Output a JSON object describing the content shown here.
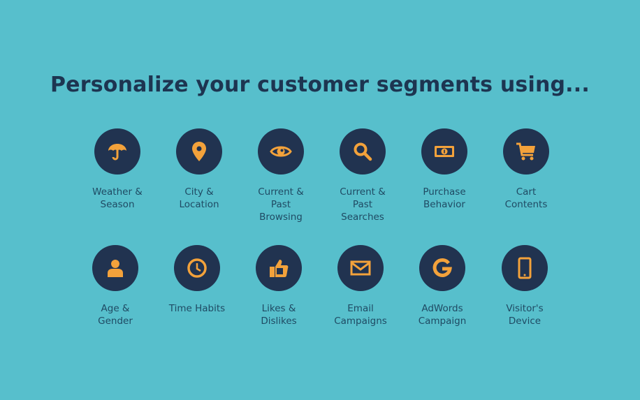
{
  "title": "Personalize your customer segments using...",
  "colors": {
    "background": "#57bfcc",
    "circle": "#213350",
    "icon": "#f3a23b",
    "text": "#1d3551"
  },
  "segments": [
    {
      "label": "Weather &\nSeason",
      "icon": "umbrella-icon"
    },
    {
      "label": "City &\nLocation",
      "icon": "map-pin-icon"
    },
    {
      "label": "Current &\nPast\nBrowsing",
      "icon": "eye-icon"
    },
    {
      "label": "Current &\nPast\nSearches",
      "icon": "search-icon"
    },
    {
      "label": "Purchase\nBehavior",
      "icon": "money-bill-icon"
    },
    {
      "label": "Cart\nContents",
      "icon": "shopping-cart-icon"
    },
    {
      "label": "Age &\nGender",
      "icon": "user-icon"
    },
    {
      "label": "Time Habits",
      "icon": "clock-icon"
    },
    {
      "label": "Likes &\nDislikes",
      "icon": "thumbs-up-icon"
    },
    {
      "label": "Email\nCampaigns",
      "icon": "envelope-icon"
    },
    {
      "label": "AdWords\nCampaign",
      "icon": "google-icon"
    },
    {
      "label": "Visitor's\nDevice",
      "icon": "mobile-phone-icon"
    }
  ]
}
